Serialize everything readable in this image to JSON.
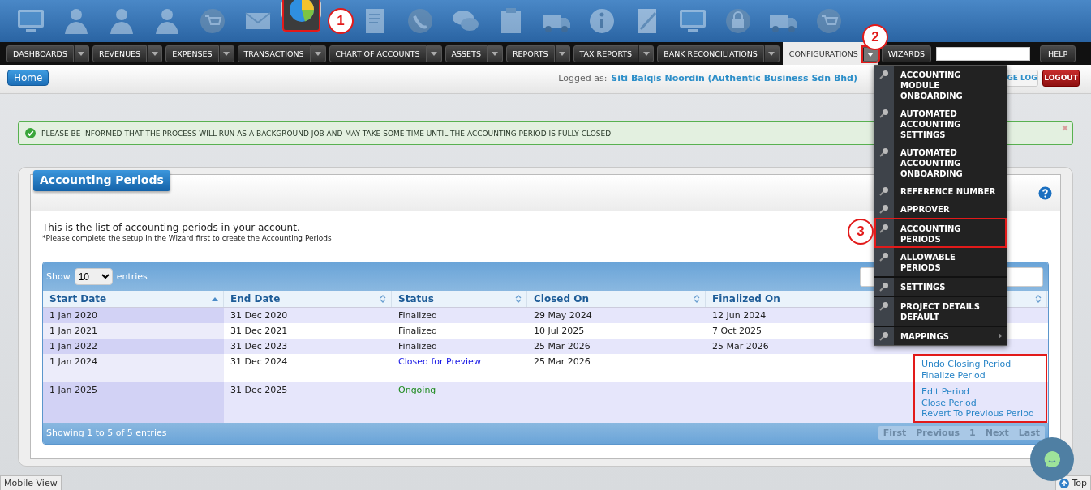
{
  "top_icons": [
    {
      "kind": "monitor",
      "selected": false
    },
    {
      "kind": "person",
      "selected": false
    },
    {
      "kind": "person",
      "selected": false
    },
    {
      "kind": "person",
      "selected": false
    },
    {
      "kind": "cart",
      "selected": false
    },
    {
      "kind": "envelope",
      "selected": false
    },
    {
      "kind": "pie",
      "selected": true,
      "highlighted": true,
      "marker": "1"
    },
    {
      "kind": "document",
      "selected": false
    },
    {
      "kind": "phone",
      "selected": false
    },
    {
      "kind": "chat",
      "selected": false
    },
    {
      "kind": "clipboard",
      "selected": false
    },
    {
      "kind": "truck",
      "selected": false
    },
    {
      "kind": "info",
      "selected": false
    },
    {
      "kind": "note",
      "selected": false
    },
    {
      "kind": "monitor",
      "selected": false
    },
    {
      "kind": "lock",
      "selected": false
    },
    {
      "kind": "truck",
      "selected": false
    },
    {
      "kind": "cart",
      "selected": false
    }
  ],
  "nav": [
    {
      "label": "DASHBOARDS",
      "selected": false,
      "caret": true
    },
    {
      "label": "REVENUES",
      "selected": false,
      "caret": true
    },
    {
      "label": "EXPENSES",
      "selected": false,
      "caret": true
    },
    {
      "label": "TRANSACTIONS",
      "selected": false,
      "caret": true
    },
    {
      "label": "CHART OF ACCOUNTS",
      "selected": false,
      "caret": true
    },
    {
      "label": "ASSETS",
      "selected": false,
      "caret": true
    },
    {
      "label": "REPORTS",
      "selected": false,
      "caret": true
    },
    {
      "label": "TAX REPORTS",
      "selected": false,
      "caret": true
    },
    {
      "label": "BANK RECONCILIATIONS",
      "selected": false,
      "caret": true
    },
    {
      "label": "CONFIGURATIONS",
      "selected": true,
      "caret": true,
      "caret_highlighted": true,
      "marker": "2"
    },
    {
      "label": "WIZARDS",
      "selected": false,
      "caret": false
    }
  ],
  "help_button": "HELP",
  "home_button": "Home",
  "logged_as": {
    "label": "Logged as:",
    "user": "Siti Balqis Noordin (Authentic Business Sdn Bhd)"
  },
  "change_log_button": "GE LOG",
  "logout_button": "LOGOUT",
  "dropdown": [
    {
      "label": "ACCOUNTING MODULE ONBOARDING",
      "divider_above": false,
      "highlighted": false,
      "submenu": false
    },
    {
      "label": "AUTOMATED ACCOUNTING SETTINGS",
      "divider_above": false,
      "highlighted": false,
      "submenu": false
    },
    {
      "label": "AUTOMATED ACCOUNTING ONBOARDING",
      "divider_above": false,
      "highlighted": false,
      "submenu": false
    },
    {
      "label": "REFERENCE NUMBER",
      "divider_above": false,
      "highlighted": false,
      "submenu": false
    },
    {
      "label": "APPROVER",
      "divider_above": false,
      "highlighted": false,
      "submenu": false
    },
    {
      "label": "ACCOUNTING PERIODS",
      "divider_above": true,
      "highlighted": true,
      "submenu": false,
      "marker": "3"
    },
    {
      "label": "ALLOWABLE PERIODS",
      "divider_above": false,
      "highlighted": false,
      "submenu": false
    },
    {
      "label": "SETTINGS",
      "divider_above": true,
      "highlighted": false,
      "submenu": false
    },
    {
      "label": "PROJECT DETAILS DEFAULT",
      "divider_above": true,
      "highlighted": false,
      "submenu": false
    },
    {
      "label": "MAPPINGS",
      "divider_above": true,
      "highlighted": false,
      "submenu": true
    }
  ],
  "alert": {
    "text": "PLEASE BE INFORMED THAT THE PROCESS WILL RUN AS A BACKGROUND JOB AND MAY TAKE SOME TIME UNTIL THE ACCOUNTING PERIOD IS FULLY CLOSED"
  },
  "panel": {
    "title": "Accounting Periods",
    "intro": "This is the list of accounting periods in your account.",
    "note": "*Please complete the setup in the Wizard first to create the Accounting Periods"
  },
  "table": {
    "show_label": "Show",
    "page_size": "10",
    "entries_label": "entries",
    "columns": [
      {
        "label": "Start Date",
        "sorted": true
      },
      {
        "label": "End Date",
        "sorted": false
      },
      {
        "label": "Status",
        "sorted": false
      },
      {
        "label": "Closed On",
        "sorted": false
      },
      {
        "label": "Finalized On",
        "sorted": false
      },
      {
        "sorted": false
      }
    ],
    "rows": [
      {
        "start": "1 Jan 2020",
        "end": "31 Dec 2020",
        "status": "Finalized",
        "color": "#222222",
        "closed_on": "29 May 2024",
        "finalized_on": "12 Jun 2024",
        "actions": [],
        "highlighted": false
      },
      {
        "start": "1 Jan 2021",
        "end": "31 Dec 2021",
        "status": "Finalized",
        "color": "#222222",
        "closed_on": "10 Jul 2025",
        "finalized_on": "7 Oct 2025",
        "actions": [],
        "highlighted": false
      },
      {
        "start": "1 Jan 2022",
        "end": "31 Dec 2023",
        "status": "Finalized",
        "color": "#222222",
        "closed_on": "25 Mar 2026",
        "finalized_on": "25 Mar 2026",
        "actions": [],
        "highlighted": false
      },
      {
        "start": "1 Jan 2024",
        "end": "31 Dec 2024",
        "status": "Closed for Preview",
        "color": "#1a1ae6",
        "closed_on": "25 Mar 2026",
        "actions": [
          "Undo Closing Period",
          "Finalize Period"
        ],
        "highlighted": true
      },
      {
        "start": "1 Jan 2025",
        "end": "31 Dec 2025",
        "status": "Ongoing",
        "color": "#1d8a1d",
        "actions": [
          "Edit Period",
          "Close Period",
          "Revert To Previous Period"
        ],
        "highlighted": true
      }
    ],
    "info": "Showing 1 to 5 of 5 entries",
    "paging": [
      {
        "label": "First",
        "disabled": true
      },
      {
        "label": "Previous",
        "disabled": true
      },
      {
        "label": "1",
        "disabled": true
      },
      {
        "label": "Next",
        "disabled": true
      },
      {
        "label": "Last",
        "disabled": true
      }
    ]
  },
  "mobile_view": "Mobile View",
  "top_button": "Top"
}
